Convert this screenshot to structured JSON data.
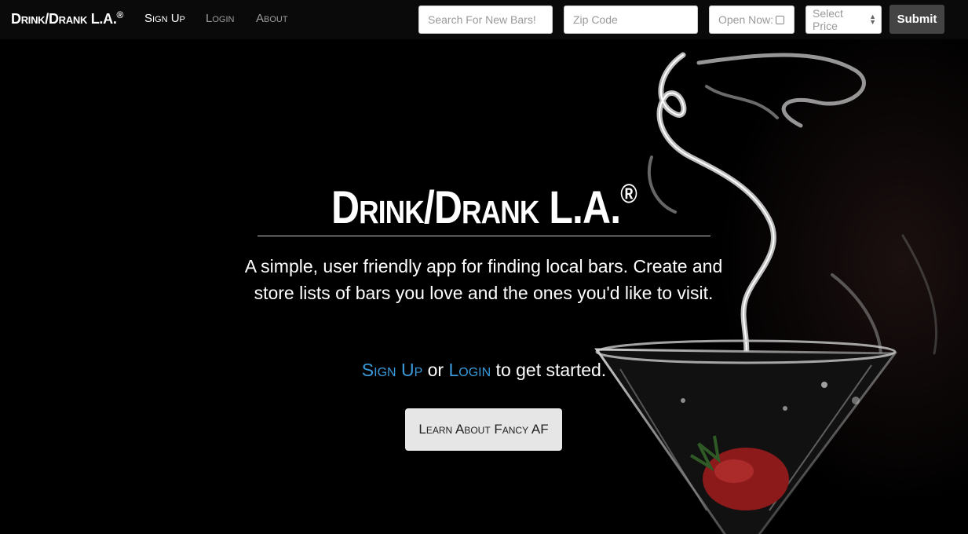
{
  "nav": {
    "brand": "Drink/Drank L.A.",
    "brand_mark": "®",
    "signup": "Sign Up",
    "login": "Login",
    "about": "About"
  },
  "search": {
    "bars_placeholder": "Search For New Bars!",
    "zip_placeholder": "Zip Code",
    "open_now_label": "Open Now:",
    "price_selected": "Select Price",
    "submit_label": "Submit"
  },
  "hero": {
    "title": "Drink/Drank L.A.",
    "title_mark": "®",
    "tagline": "A simple, user friendly app for finding local bars. Create and store lists of bars you love and the ones you'd like to visit.",
    "cta_signup": "Sign Up",
    "cta_or": " or ",
    "cta_login": "Login",
    "cta_rest": " to get started.",
    "learn_button": "Learn About Fancy AF"
  },
  "colors": {
    "link": "#3a9ad9",
    "background": "#000000",
    "navbar": "#0a0a0a"
  }
}
